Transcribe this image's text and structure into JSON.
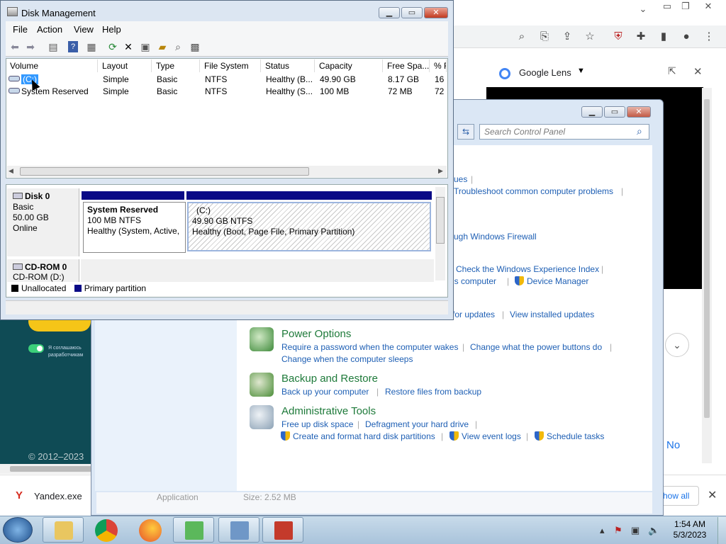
{
  "chrome": {
    "lens_title": "Google Lens",
    "no_text": "No",
    "show_all": "Show all",
    "download_file": "Yandex.exe",
    "page_copyright": "© 2012–2023",
    "ru_text": "Я соглашаюсь разработчикам"
  },
  "control_panel": {
    "search_placeholder": "Search Control Panel",
    "partial_links": {
      "l1": "ues",
      "l2": "Troubleshoot common computer problems",
      "l3": "ugh Windows Firewall",
      "l4": "Check the Windows Experience Index",
      "l5": "is computer",
      "l6": "Device Manager",
      "l7": "for updates",
      "l8": "View installed updates"
    },
    "sections": [
      {
        "heading": "Power Options",
        "links": [
          "Require a password when the computer wakes",
          "Change what the power buttons do",
          "Change when the computer sleeps"
        ]
      },
      {
        "heading": "Backup and Restore",
        "links": [
          "Back up your computer",
          "Restore files from backup"
        ]
      },
      {
        "heading": "Administrative Tools",
        "links": [
          "Free up disk space",
          "Defragment your hard drive",
          "Create and format hard disk partitions",
          "View event logs",
          "Schedule tasks"
        ]
      }
    ],
    "behind_row": {
      "type": "Application",
      "size": "Size: 2.52 MB"
    }
  },
  "disk_mgmt": {
    "title": "Disk Management",
    "menu": [
      "File",
      "Action",
      "View",
      "Help"
    ],
    "columns": [
      "Volume",
      "Layout",
      "Type",
      "File System",
      "Status",
      "Capacity",
      "Free Spa...",
      "% F"
    ],
    "rows": [
      [
        "(C:)",
        "Simple",
        "Basic",
        "NTFS",
        "Healthy (B...",
        "49.90 GB",
        "8.17 GB",
        "16"
      ],
      [
        "System Reserved",
        "Simple",
        "Basic",
        "NTFS",
        "Healthy (S...",
        "100 MB",
        "72 MB",
        "72"
      ]
    ],
    "disk0": {
      "name": "Disk 0",
      "type": "Basic",
      "size": "50.00 GB",
      "state": "Online"
    },
    "partitions": [
      {
        "name": "System Reserved",
        "size": "100 MB NTFS",
        "status": "Healthy (System, Active,"
      },
      {
        "name": "(C:)",
        "size": "49.90 GB NTFS",
        "status": "Healthy (Boot, Page File, Primary Partition)"
      }
    ],
    "cdrom": {
      "name": "CD-ROM 0",
      "drive": "CD-ROM (D:)"
    },
    "legend": [
      "Unallocated",
      "Primary partition"
    ],
    "legend_colors": [
      "#000000",
      "#0a0a86"
    ]
  },
  "taskbar": {
    "time": "1:54 AM",
    "date": "5/3/2023"
  }
}
